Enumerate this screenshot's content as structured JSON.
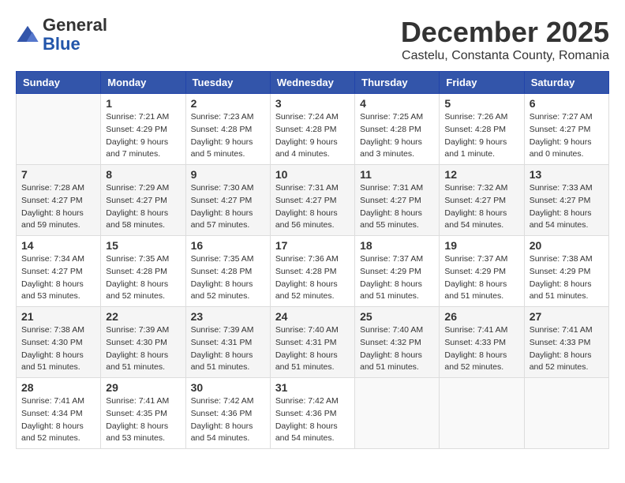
{
  "header": {
    "logo_line1": "General",
    "logo_line2": "Blue",
    "month_title": "December 2025",
    "location": "Castelu, Constanta County, Romania"
  },
  "calendar": {
    "days_of_week": [
      "Sunday",
      "Monday",
      "Tuesday",
      "Wednesday",
      "Thursday",
      "Friday",
      "Saturday"
    ],
    "weeks": [
      [
        {
          "day": "",
          "info": ""
        },
        {
          "day": "1",
          "info": "Sunrise: 7:21 AM\nSunset: 4:29 PM\nDaylight: 9 hours\nand 7 minutes."
        },
        {
          "day": "2",
          "info": "Sunrise: 7:23 AM\nSunset: 4:28 PM\nDaylight: 9 hours\nand 5 minutes."
        },
        {
          "day": "3",
          "info": "Sunrise: 7:24 AM\nSunset: 4:28 PM\nDaylight: 9 hours\nand 4 minutes."
        },
        {
          "day": "4",
          "info": "Sunrise: 7:25 AM\nSunset: 4:28 PM\nDaylight: 9 hours\nand 3 minutes."
        },
        {
          "day": "5",
          "info": "Sunrise: 7:26 AM\nSunset: 4:28 PM\nDaylight: 9 hours\nand 1 minute."
        },
        {
          "day": "6",
          "info": "Sunrise: 7:27 AM\nSunset: 4:27 PM\nDaylight: 9 hours\nand 0 minutes."
        }
      ],
      [
        {
          "day": "7",
          "info": "Sunrise: 7:28 AM\nSunset: 4:27 PM\nDaylight: 8 hours\nand 59 minutes."
        },
        {
          "day": "8",
          "info": "Sunrise: 7:29 AM\nSunset: 4:27 PM\nDaylight: 8 hours\nand 58 minutes."
        },
        {
          "day": "9",
          "info": "Sunrise: 7:30 AM\nSunset: 4:27 PM\nDaylight: 8 hours\nand 57 minutes."
        },
        {
          "day": "10",
          "info": "Sunrise: 7:31 AM\nSunset: 4:27 PM\nDaylight: 8 hours\nand 56 minutes."
        },
        {
          "day": "11",
          "info": "Sunrise: 7:31 AM\nSunset: 4:27 PM\nDaylight: 8 hours\nand 55 minutes."
        },
        {
          "day": "12",
          "info": "Sunrise: 7:32 AM\nSunset: 4:27 PM\nDaylight: 8 hours\nand 54 minutes."
        },
        {
          "day": "13",
          "info": "Sunrise: 7:33 AM\nSunset: 4:27 PM\nDaylight: 8 hours\nand 54 minutes."
        }
      ],
      [
        {
          "day": "14",
          "info": "Sunrise: 7:34 AM\nSunset: 4:27 PM\nDaylight: 8 hours\nand 53 minutes."
        },
        {
          "day": "15",
          "info": "Sunrise: 7:35 AM\nSunset: 4:28 PM\nDaylight: 8 hours\nand 52 minutes."
        },
        {
          "day": "16",
          "info": "Sunrise: 7:35 AM\nSunset: 4:28 PM\nDaylight: 8 hours\nand 52 minutes."
        },
        {
          "day": "17",
          "info": "Sunrise: 7:36 AM\nSunset: 4:28 PM\nDaylight: 8 hours\nand 52 minutes."
        },
        {
          "day": "18",
          "info": "Sunrise: 7:37 AM\nSunset: 4:29 PM\nDaylight: 8 hours\nand 51 minutes."
        },
        {
          "day": "19",
          "info": "Sunrise: 7:37 AM\nSunset: 4:29 PM\nDaylight: 8 hours\nand 51 minutes."
        },
        {
          "day": "20",
          "info": "Sunrise: 7:38 AM\nSunset: 4:29 PM\nDaylight: 8 hours\nand 51 minutes."
        }
      ],
      [
        {
          "day": "21",
          "info": "Sunrise: 7:38 AM\nSunset: 4:30 PM\nDaylight: 8 hours\nand 51 minutes."
        },
        {
          "day": "22",
          "info": "Sunrise: 7:39 AM\nSunset: 4:30 PM\nDaylight: 8 hours\nand 51 minutes."
        },
        {
          "day": "23",
          "info": "Sunrise: 7:39 AM\nSunset: 4:31 PM\nDaylight: 8 hours\nand 51 minutes."
        },
        {
          "day": "24",
          "info": "Sunrise: 7:40 AM\nSunset: 4:31 PM\nDaylight: 8 hours\nand 51 minutes."
        },
        {
          "day": "25",
          "info": "Sunrise: 7:40 AM\nSunset: 4:32 PM\nDaylight: 8 hours\nand 51 minutes."
        },
        {
          "day": "26",
          "info": "Sunrise: 7:41 AM\nSunset: 4:33 PM\nDaylight: 8 hours\nand 52 minutes."
        },
        {
          "day": "27",
          "info": "Sunrise: 7:41 AM\nSunset: 4:33 PM\nDaylight: 8 hours\nand 52 minutes."
        }
      ],
      [
        {
          "day": "28",
          "info": "Sunrise: 7:41 AM\nSunset: 4:34 PM\nDaylight: 8 hours\nand 52 minutes."
        },
        {
          "day": "29",
          "info": "Sunrise: 7:41 AM\nSunset: 4:35 PM\nDaylight: 8 hours\nand 53 minutes."
        },
        {
          "day": "30",
          "info": "Sunrise: 7:42 AM\nSunset: 4:36 PM\nDaylight: 8 hours\nand 54 minutes."
        },
        {
          "day": "31",
          "info": "Sunrise: 7:42 AM\nSunset: 4:36 PM\nDaylight: 8 hours\nand 54 minutes."
        },
        {
          "day": "",
          "info": ""
        },
        {
          "day": "",
          "info": ""
        },
        {
          "day": "",
          "info": ""
        }
      ]
    ]
  }
}
